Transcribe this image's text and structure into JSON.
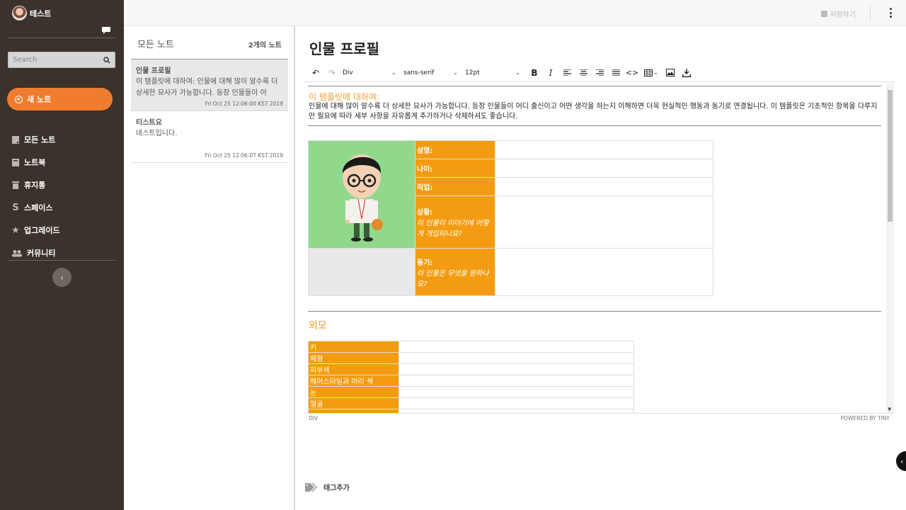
{
  "user": {
    "name": "테스트"
  },
  "search": {
    "placeholder": "Search"
  },
  "sidebar": {
    "new_note": "새 노트",
    "items": [
      {
        "label": "모든 노트",
        "icon": "note-icon"
      },
      {
        "label": "노트북",
        "icon": "notebook-icon"
      },
      {
        "label": "휴지통",
        "icon": "trash-icon"
      },
      {
        "label": "스페이스",
        "icon": "space-icon"
      },
      {
        "label": "업그레이드",
        "icon": "star-icon"
      },
      {
        "label": "커뮤니티",
        "icon": "users-icon"
      }
    ]
  },
  "topbar": {
    "save_label": "저장하기"
  },
  "notelist": {
    "title": "모든 노트",
    "count": "2개의 노트",
    "notes": [
      {
        "title": "인물 프로필",
        "body": "이 템플릿에 대하여: 인물에 대해 많이 알수록 더 상세한 묘사가 가능합니다. 등장 인물들이 어",
        "date": "Fri Oct 25 12:06:00 KST 2019"
      },
      {
        "title": "티스트요",
        "body": "네스트입니다.",
        "date": "Fri Oct 25 12:06:07 KST 2019"
      }
    ]
  },
  "editor": {
    "title": "인물 프로필",
    "toolbar": {
      "block": "Div",
      "font": "sans-serif",
      "size": "12pt"
    },
    "about_title": "이 템플릿에 대하여:",
    "about_text": "인물에 대해 많이 알수록 더 상세한 묘사가 가능합니다. 등장 인물들이 어디 출신이고 어떤 생각을 하는지 이해하면 더욱 현실적인 행동과 동기로 연결됩니다. 이 템플릿은 기초적인 항목을 다루지만 필요에 따라 세부 사항을 자유롭게 추가하거나 삭제하셔도 좋습니다.",
    "profile": {
      "name_label": "성명:",
      "age_label": "나이:",
      "job_label": "직업:",
      "situation_label": "상황:",
      "situation_hint": "이 인물이 이야기에 어떻게 개입되나요?",
      "motive_label": "동기:",
      "motive_hint": "이 인물은 무엇을 원하나요?"
    },
    "appearance_title": "외모",
    "appearance_rows": [
      "키",
      "체형",
      "피부색",
      "헤어스타일과 머리 색",
      "눈",
      "얼굴"
    ],
    "status_path": "DIV",
    "powered_by": "POWERED BY TINY"
  },
  "tags": {
    "add_label": "태그추가"
  },
  "colors": {
    "sidebar_bg": "#3b322c",
    "accent": "#f07d2f",
    "table_label": "#f39c12"
  }
}
